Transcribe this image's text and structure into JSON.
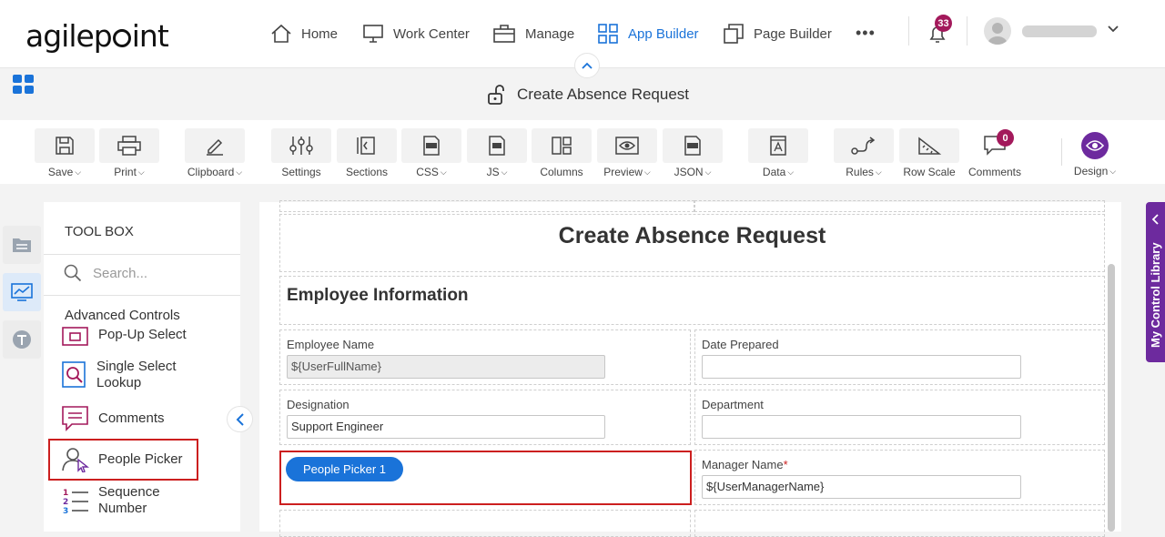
{
  "brand": {
    "logo_text_a": "agilep",
    "logo_text_b": "int"
  },
  "nav": {
    "items": [
      {
        "label": "Home"
      },
      {
        "label": "Work Center"
      },
      {
        "label": "Manage"
      },
      {
        "label": "App Builder"
      },
      {
        "label": "Page Builder"
      }
    ],
    "more": "•••",
    "notifications": "33",
    "active_color": "#1a73d9"
  },
  "titlebar": {
    "form_title": "Create Absence Request"
  },
  "toolbar": {
    "items": [
      {
        "label": "Save",
        "dropdown": true
      },
      {
        "label": "Print",
        "dropdown": true
      },
      {
        "label": "Clipboard",
        "dropdown": true
      },
      {
        "label": "Settings"
      },
      {
        "label": "Sections"
      },
      {
        "label": "CSS",
        "dropdown": true
      },
      {
        "label": "JS",
        "dropdown": true
      },
      {
        "label": "Columns"
      },
      {
        "label": "Preview",
        "dropdown": true
      },
      {
        "label": "JSON",
        "dropdown": true
      },
      {
        "label": "Data",
        "dropdown": true
      },
      {
        "label": "Rules",
        "dropdown": true
      },
      {
        "label": "Row Scale"
      },
      {
        "label": "Comments"
      },
      {
        "label": "Design",
        "dropdown": true
      }
    ],
    "comments_count": "0",
    "chevron": "⌵",
    "design_color": "#6d2a9e"
  },
  "toolbox": {
    "title": "TOOL BOX",
    "search_placeholder": "Search...",
    "section": "Advanced Controls",
    "items": [
      {
        "label": "Pop-Up Select"
      },
      {
        "label": "Single Select Lookup"
      },
      {
        "label": "Comments"
      },
      {
        "label": "People Picker"
      },
      {
        "label": "Sequence Number"
      }
    ]
  },
  "form": {
    "heading": "Create Absence Request",
    "section": "Employee Information",
    "fields": {
      "employee_name": {
        "label": "Employee Name",
        "value": "${UserFullName}"
      },
      "date_prepared": {
        "label": "Date Prepared",
        "value": ""
      },
      "designation": {
        "label": "Designation",
        "value": "Support Engineer"
      },
      "department": {
        "label": "Department",
        "value": ""
      },
      "manager_name": {
        "label": "Manager Name",
        "required": "*",
        "value": "${UserManagerName}"
      }
    },
    "people_picker": "People Picker 1"
  },
  "side_panel": {
    "label": "My Control Library",
    "color": "#6d2a9e"
  },
  "highlight_color": "#cc1f1f"
}
